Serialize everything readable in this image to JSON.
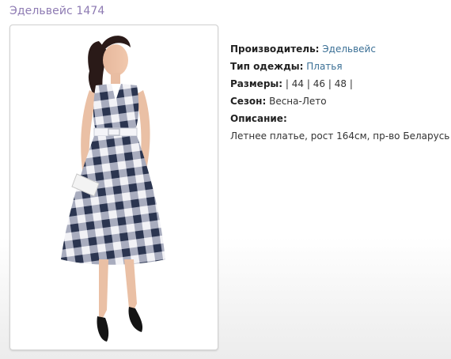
{
  "product": {
    "title": "Эдельвейс 1474"
  },
  "details": {
    "manufacturer_label": "Производитель:",
    "manufacturer_value": "Эдельвейс",
    "type_label": "Тип одежды:",
    "type_value": "Платья",
    "sizes_label": "Размеры:",
    "sizes_separator": "|",
    "sizes": [
      "44",
      "46",
      "48"
    ],
    "season_label": "Сезон:",
    "season_value": "Весна-Лето",
    "description_label": "Описание:",
    "description_text": "Летнее платье, рост 164см, пр-во Беларусь"
  },
  "colors": {
    "title": "#8e7bb3",
    "link": "#3a6f95",
    "dress_navy": "#2b3550",
    "dress_white": "#f2f2f6"
  }
}
